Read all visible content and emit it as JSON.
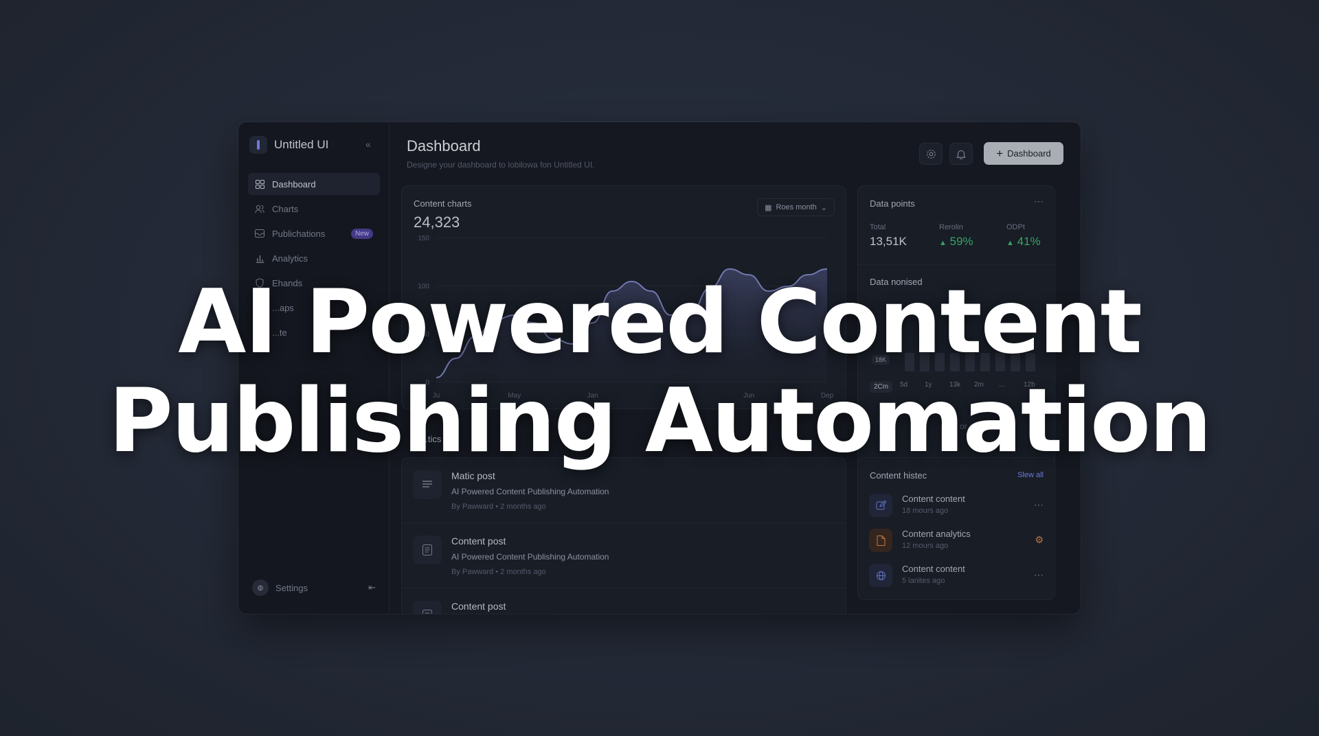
{
  "sidebar": {
    "brand": "Untitled UI",
    "items": [
      {
        "label": "Dashboard",
        "icon": "grid-icon",
        "active": true
      },
      {
        "label": "Charts",
        "icon": "users-icon"
      },
      {
        "label": "Publichations",
        "icon": "inbox-icon",
        "badge": "New"
      },
      {
        "label": "Analytics",
        "icon": "bar-chart-icon"
      },
      {
        "label": "Ehands",
        "icon": "shield-icon"
      },
      {
        "label": "...aps",
        "icon": "gear-icon"
      },
      {
        "label": "...te",
        "icon": "file-icon"
      }
    ],
    "footer": {
      "label": "Settings"
    }
  },
  "header": {
    "title": "Dashboard",
    "subtitle": "Designe your dashboard to lobilowa fon Untitled UI.",
    "primary_button": "Dashboard"
  },
  "content_chart": {
    "title": "Content charts",
    "total": "24,323",
    "range_select": "Roes month"
  },
  "chart_data": {
    "type": "area",
    "x_ticks": [
      "Ju",
      "May",
      "Jan",
      "...th",
      "Jun",
      "Dep"
    ],
    "y_ticks": [
      "150",
      "100",
      "50",
      "0"
    ],
    "ylim": [
      0,
      150
    ],
    "x": [
      0,
      1,
      2,
      3,
      4,
      5,
      6,
      7,
      8,
      9,
      10,
      11,
      12,
      13,
      14,
      15,
      16,
      17,
      18,
      19,
      20
    ],
    "values": [
      5,
      25,
      48,
      65,
      70,
      62,
      45,
      40,
      62,
      95,
      105,
      95,
      70,
      72,
      98,
      118,
      112,
      95,
      100,
      112,
      118
    ]
  },
  "data_points": {
    "title": "Data points",
    "stats": [
      {
        "label": "Total",
        "value": "13,51K"
      },
      {
        "label": "Rerolin",
        "value": "59%",
        "up": true
      },
      {
        "label": "ODPt",
        "value": "41%",
        "up": true
      }
    ],
    "section2_title": "Data nonised",
    "bar_marker": "18K",
    "bars": [
      0.55,
      0.55,
      0.55,
      0.55,
      0.55,
      0.55,
      0.55,
      0.55,
      0.55
    ],
    "periods": [
      "2Cm",
      "5d",
      "1y",
      "13k",
      "2m",
      "...",
      "12b"
    ],
    "footer_text": "or"
  },
  "metrics_label": "...tics",
  "posts": [
    {
      "title": "Matic post",
      "desc": "AI Powered Content Publishing Automation",
      "meta": "By Pawward • 2 months ago"
    },
    {
      "title": "Content post",
      "desc": "AI Powered Content Publishing Automation",
      "meta": "By Pawward • 2 months ago"
    },
    {
      "title": "Content post",
      "desc": "",
      "meta": ""
    }
  ],
  "history": {
    "title": "Content histec",
    "view_all": "Slew all",
    "items": [
      {
        "title": "Content content",
        "meta": "18 mours ago",
        "icon": "edit-icon",
        "color": "#6e7fe0"
      },
      {
        "title": "Content analytics",
        "meta": "12 mours ago",
        "icon": "document-icon",
        "color": "#d9844a"
      },
      {
        "title": "Content content",
        "meta": "5 lanites ago",
        "icon": "globe-icon",
        "color": "#6e7fe0"
      }
    ]
  },
  "overlay": {
    "line1": "AI Powered Content",
    "line2": "Publishing Automation"
  },
  "colors": {
    "background": "#252b38",
    "panel": "#171b24",
    "accent": "#7c86f2",
    "positive": "#3fb56f",
    "badge": "#4c3f96"
  }
}
